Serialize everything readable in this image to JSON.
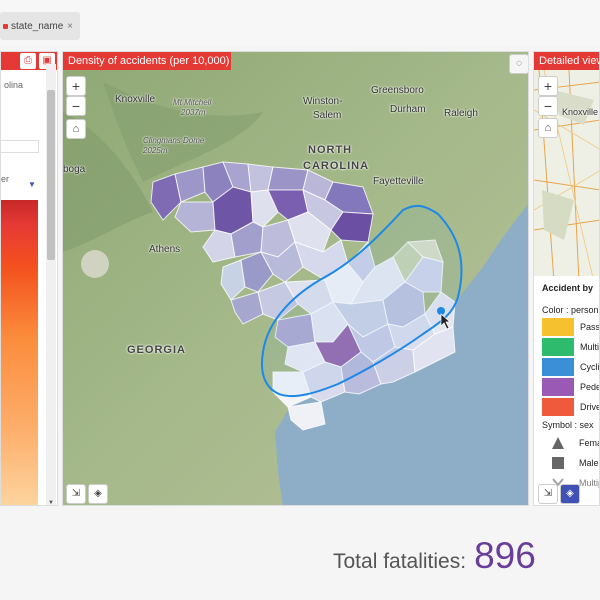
{
  "filter_chip": {
    "label": "state_name",
    "close": "×"
  },
  "left_panel": {
    "text_top": "olina",
    "text_mid": "er",
    "print_icon": "⎙",
    "export_icon": "▣"
  },
  "map_panel": {
    "title": "Density of accidents (per 10,000)",
    "zoom_in": "+",
    "zoom_out": "−",
    "labels": {
      "knoxville": "Knoxville",
      "mt_mitchell": "Mt Mitchell",
      "mt_mitchell_elev": "2037m",
      "clingmans": "Clingmans Dome",
      "clingmans_elev": "2025m",
      "winston": "Winston-",
      "salem": "Salem",
      "greensboro": "Greensboro",
      "durham": "Durham",
      "raleigh": "Raleigh",
      "north": "NORTH",
      "carolina": "CAROLINA",
      "fayetteville": "Fayetteville",
      "athens": "Athens",
      "georgia": "GEORGIA",
      "boga": "boga"
    }
  },
  "right_panel": {
    "title": "Detailed view",
    "zoom_in": "+",
    "zoom_out": "−",
    "knoxville": "Knoxville",
    "legend": {
      "title": "Accident by",
      "color_label": "Color : person",
      "items": [
        {
          "label": "Passenger",
          "color": "#f6c12f"
        },
        {
          "label": "Multiple",
          "color": "#2ebb6d"
        },
        {
          "label": "Cyclist",
          "color": "#3b8fd6"
        },
        {
          "label": "Pedestrian",
          "color": "#9b59b6"
        },
        {
          "label": "Driver",
          "color": "#ef5a3c"
        }
      ],
      "symbol_label": "Symbol : sex",
      "symbols": [
        {
          "label": "Female",
          "shape": "triangle"
        },
        {
          "label": "Male",
          "shape": "square"
        },
        {
          "label": "Multiple",
          "shape": "chevron"
        }
      ]
    }
  },
  "totals": {
    "label": "Total fatalities:",
    "value": "896"
  },
  "colors": {
    "accent": "#e53935",
    "lasso": "#1e88e5",
    "total_value": "#6a3d9a"
  }
}
